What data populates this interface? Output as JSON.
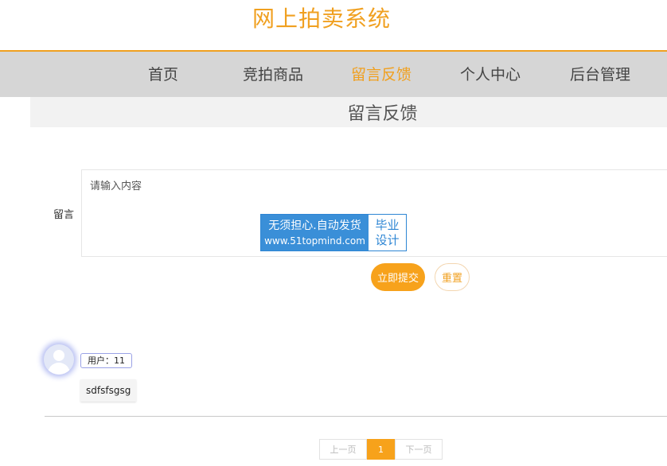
{
  "site": {
    "title": "网上拍卖系统"
  },
  "nav": {
    "items": [
      {
        "label": "首页"
      },
      {
        "label": "竞拍商品"
      },
      {
        "label": "留言反馈"
      },
      {
        "label": "个人中心"
      },
      {
        "label": "后台管理"
      }
    ],
    "active": "留言反馈"
  },
  "section": {
    "title": "留言反馈"
  },
  "form": {
    "label": "留言",
    "placeholder": "请输入内容",
    "value": "",
    "submit_label": "立即提交",
    "reset_label": "重置"
  },
  "watermark": {
    "line1": "无须担心.自动发货",
    "line2": "www.51topmind.com",
    "right_line1": "毕业",
    "right_line2": "设计"
  },
  "comments": [
    {
      "user": "用户：11",
      "text": "sdfsfsgsg"
    }
  ],
  "pagination": {
    "prev": "上一页",
    "current": "1",
    "next": "下一页"
  },
  "colors": {
    "accent": "#f7a21b",
    "nav_bg": "#d6d6d6",
    "watermark_blue": "#3a8fd8"
  }
}
